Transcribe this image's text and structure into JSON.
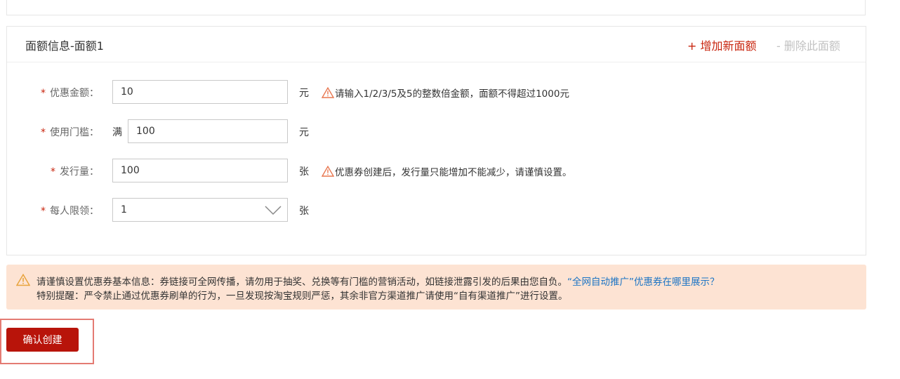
{
  "panel": {
    "title": "面额信息-面额1",
    "add_label": "+ 增加新面额",
    "remove_label": "- 删除此面额"
  },
  "form": {
    "required_mark": "*",
    "discount": {
      "label": "优惠金额：",
      "value": "10",
      "unit": "元",
      "hint": "请输入1/2/3/5及5的整数倍金额，面额不得超过1000元"
    },
    "threshold": {
      "label": "使用门槛：",
      "prefix": "满",
      "value": "100",
      "unit": "元"
    },
    "quantity": {
      "label": "发行量：",
      "value": "100",
      "unit": "张",
      "hint": "优惠券创建后，发行量只能增加不能减少，请谨慎设置。"
    },
    "limit": {
      "label": "每人限领：",
      "selected": "1",
      "unit": "张"
    }
  },
  "notice": {
    "line1_text": "请谨慎设置优惠券基本信息：券链接可全网传播，请勿用于抽奖、兑换等有门槛的营销活动，如链接泄露引发的后果由您自负。",
    "line1_link": "“全网自动推广”优惠券在哪里展示？",
    "line2_text": "特别提醒：严令禁止通过优惠券刷单的行为，一旦发现按淘宝规则严惩，其余非官方渠道推广请使用“自有渠道推广”进行设置。"
  },
  "confirm_label": "确认创建",
  "colors": {
    "accent_red": "#c8240d",
    "button_red": "#b8140a",
    "notice_bg": "#fde3d3",
    "link_blue": "#1c74c4",
    "warning_orange": "#e8764f"
  }
}
